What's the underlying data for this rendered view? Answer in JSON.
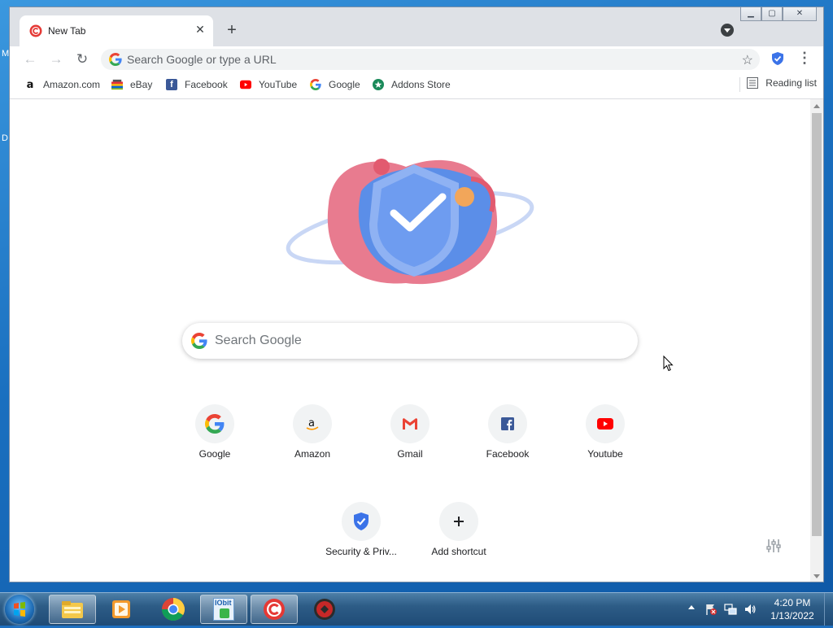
{
  "desktop": {
    "letters": [
      "M",
      "D"
    ]
  },
  "tab": {
    "title": "New Tab",
    "close_glyph": "✕"
  },
  "toolbar": {
    "newtab_glyph": "+",
    "back_glyph": "←",
    "forward_glyph": "→",
    "reload_glyph": "↻",
    "omnibox_placeholder": "Search Google or type a URL",
    "star_glyph": "☆",
    "menu_glyph": "⋮"
  },
  "window_controls": {
    "minimize": "▁",
    "maximize": "▢",
    "close": "✕"
  },
  "bookmarks": [
    {
      "label": "Amazon.com",
      "icon": "amazon-icon"
    },
    {
      "label": "eBay",
      "icon": "ebay-icon"
    },
    {
      "label": "Facebook",
      "icon": "facebook-icon"
    },
    {
      "label": "YouTube",
      "icon": "youtube-icon"
    },
    {
      "label": "Google",
      "icon": "google-icon"
    },
    {
      "label": "Addons Store",
      "icon": "addons-store-icon"
    }
  ],
  "reading_list": {
    "label": "Reading list",
    "icon": "reading-list-icon"
  },
  "search": {
    "placeholder": "Search Google"
  },
  "shortcuts": [
    {
      "label": "Google",
      "icon": "google-icon"
    },
    {
      "label": "Amazon",
      "icon": "amazon-icon"
    },
    {
      "label": "Gmail",
      "icon": "gmail-icon"
    },
    {
      "label": "Facebook",
      "icon": "facebook-icon"
    },
    {
      "label": "Youtube",
      "icon": "youtube-icon"
    },
    {
      "label": "Security & Priv...",
      "icon": "shield-icon"
    },
    {
      "label": "Add shortcut",
      "icon": "plus-icon"
    }
  ],
  "taskbar": {
    "apps": [
      "explorer-icon",
      "media-player-icon",
      "chrome-icon",
      "iobit-icon",
      "ccleaner-browser-icon",
      "security-app-icon"
    ],
    "iobit_label": "IObit",
    "clock_time": "4:20 PM",
    "clock_date": "1/13/2022"
  },
  "colors": {
    "google_blue": "#4285F4",
    "google_red": "#EA4335",
    "google_yellow": "#FBBC05",
    "google_green": "#34A853",
    "facebook_blue": "#3b5998",
    "youtube_red": "#FF0000",
    "shield_blue": "#3b73e8"
  }
}
